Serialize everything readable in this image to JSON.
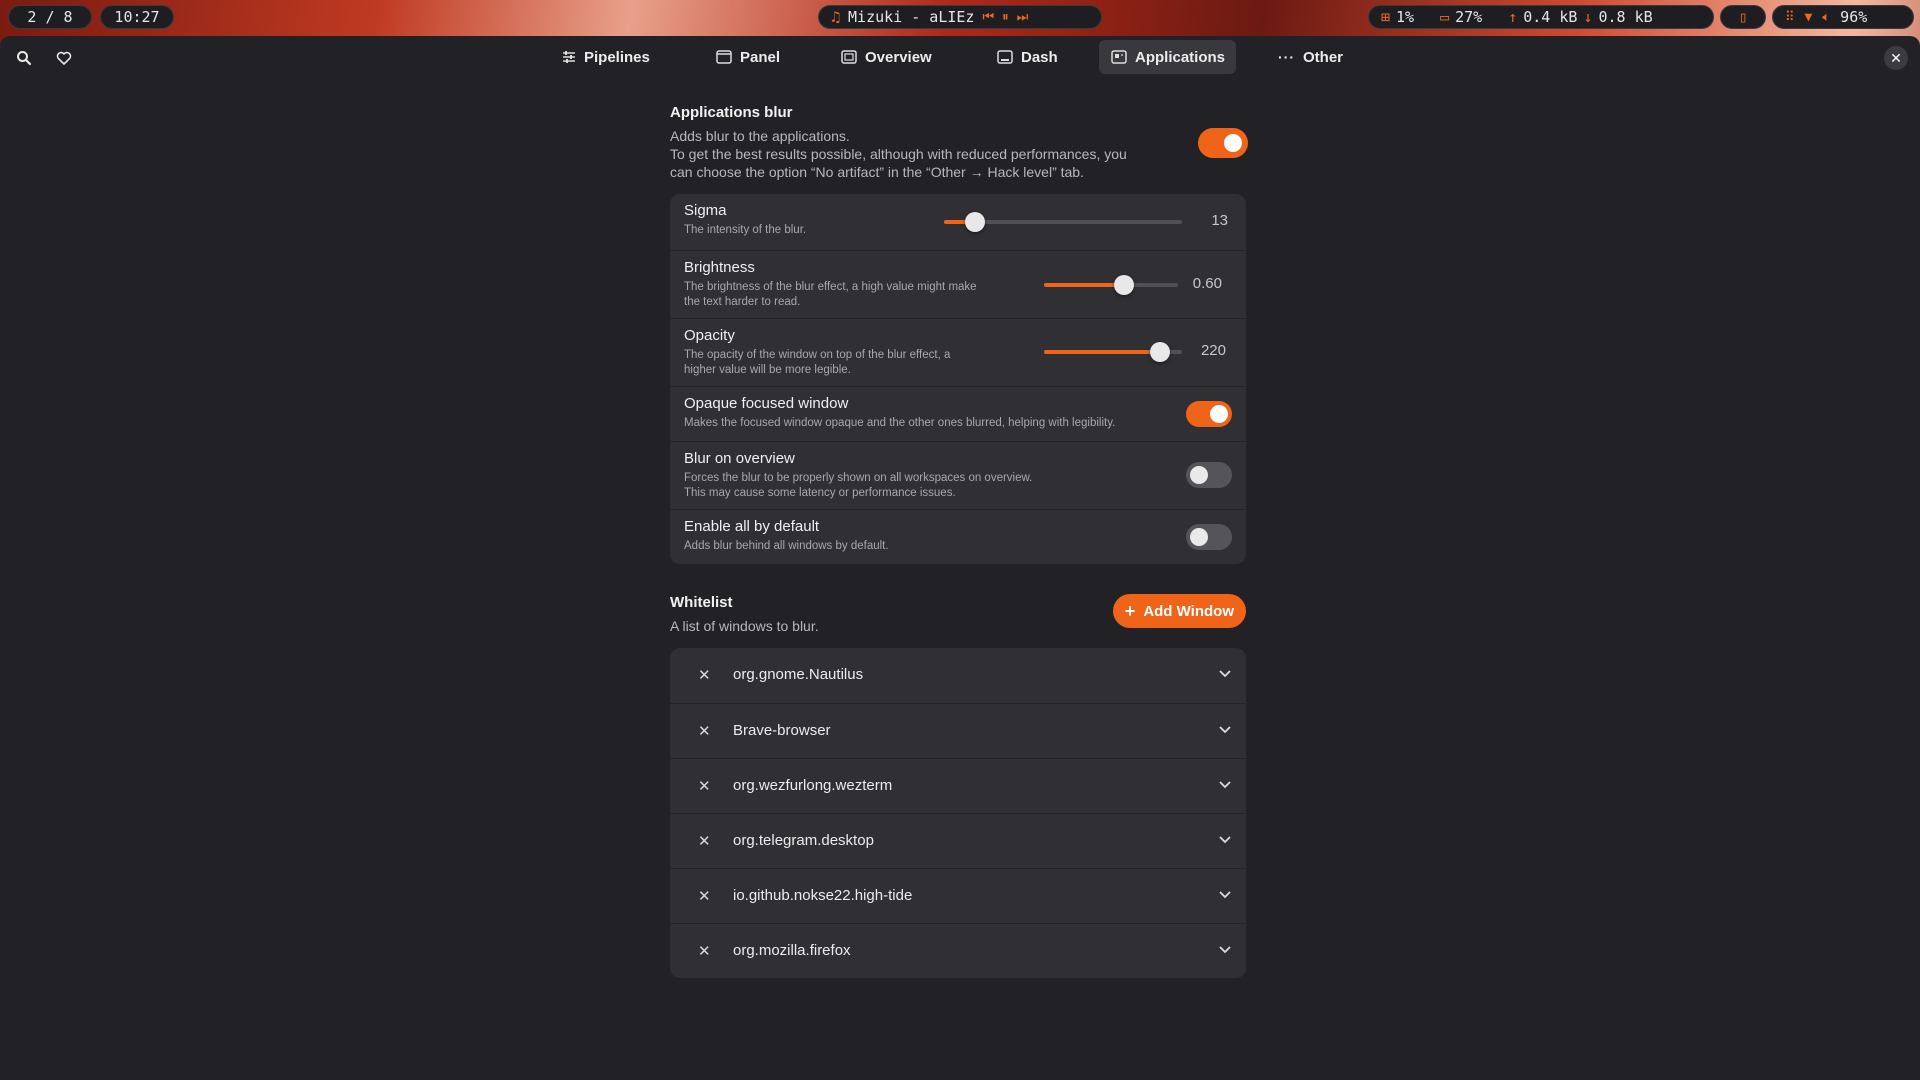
{
  "topbar": {
    "workspace": "2 / 8",
    "clock": "10:27",
    "media": {
      "track": "Mizuki - aLIEz"
    },
    "stats": {
      "cpu": "1%",
      "ram": "27%",
      "upload": "0.4 kB",
      "download": "0.8 kB"
    },
    "battery": "96%"
  },
  "tabs": [
    {
      "label": "Pipelines",
      "icon": "sliders-icon"
    },
    {
      "label": "Panel",
      "icon": "panel-icon"
    },
    {
      "label": "Overview",
      "icon": "overview-icon"
    },
    {
      "label": "Dash",
      "icon": "dash-icon"
    },
    {
      "label": "Applications",
      "icon": "applications-icon",
      "active": true
    },
    {
      "label": "Other",
      "icon": "more-icon"
    }
  ],
  "applications_blur": {
    "title": "Applications blur",
    "description_1": "Adds blur to the applications.",
    "description_2": "To get the best results possible, although with reduced performances, you",
    "description_3": "can choose the option “No artifact” in the “Other → Hack level” tab.",
    "enabled": true
  },
  "settings": {
    "sigma": {
      "title": "Sigma",
      "subtitle": "The intensity of the blur.",
      "value": "13",
      "fraction": 0.13
    },
    "brightness": {
      "title": "Brightness",
      "subtitle_1": "The brightness of the blur effect, a high value might make",
      "subtitle_2": "the text harder to read.",
      "value": "0.60",
      "fraction": 0.6
    },
    "opacity": {
      "title": "Opacity",
      "subtitle_1": "The opacity of the window on top of the blur effect, a",
      "subtitle_2": "higher value will be more legible.",
      "value": "220",
      "fraction": 0.86
    },
    "opaque_focused": {
      "title": "Opaque focused window",
      "subtitle": "Makes the focused window opaque and the other ones blurred, helping with legibility.",
      "enabled": true
    },
    "blur_overview": {
      "title": "Blur on overview",
      "subtitle_1": "Forces the blur to be properly shown on all workspaces on overview.",
      "subtitle_2": "This may cause some latency or performance issues.",
      "enabled": false
    },
    "enable_all": {
      "title": "Enable all by default",
      "subtitle": "Adds blur behind all windows by default.",
      "enabled": false
    }
  },
  "whitelist": {
    "title": "Whitelist",
    "description": "A list of windows to blur.",
    "add_label": "Add Window",
    "items": [
      "org.gnome.Nautilus",
      "Brave-browser",
      "org.wezfurlong.wezterm",
      "org.telegram.desktop",
      "io.github.nokse22.high-tide",
      "org.mozilla.firefox"
    ]
  },
  "colors": {
    "accent": "#f0641a",
    "window_bg": "#222226",
    "card_bg": "#2f2f34"
  }
}
